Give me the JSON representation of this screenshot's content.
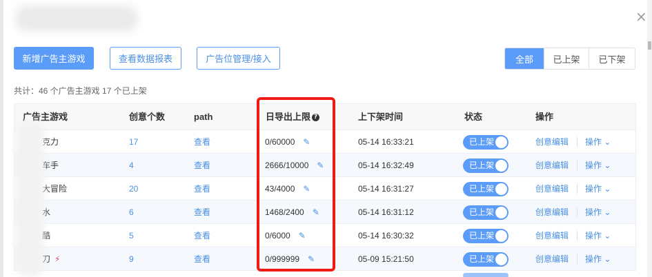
{
  "dialog": {
    "close_icon": "close-icon"
  },
  "toolbar": {
    "add_game_label": "新增广告主游戏",
    "view_report_label": "查看数据报表",
    "ad_position_label": "广告位管理/接入"
  },
  "filter": {
    "all": "全部",
    "listed": "已上架",
    "unlisted": "已下架",
    "active": "all"
  },
  "summary": "共计：46 个广告主游戏   17 个已上架",
  "columns": {
    "game": "广告主游戏",
    "creatives": "创意个数",
    "path": "path",
    "daily_limit": "日导出上限",
    "time": "上下架时间",
    "status": "状态",
    "actions": "操作"
  },
  "rows": [
    {
      "name": "克力",
      "creatives": "17",
      "path": "查看",
      "limit": "0/60000",
      "time": "05-14 16:33:21",
      "status": "已上架",
      "edit": "创意编辑",
      "more": "操作 ⌄",
      "bolt": ""
    },
    {
      "name": "车手",
      "creatives": "4",
      "path": "查看",
      "limit": "2666/10000",
      "time": "05-14 16:32:49",
      "status": "已上架",
      "edit": "创意编辑",
      "more": "操作 ⌄",
      "bolt": ""
    },
    {
      "name": "大冒险",
      "creatives": "20",
      "path": "查看",
      "limit": "43/4000",
      "time": "05-14 16:31:27",
      "status": "已上架",
      "edit": "创意编辑",
      "more": "操作 ⌄",
      "bolt": ""
    },
    {
      "name": "水",
      "creatives": "6",
      "path": "查看",
      "limit": "1468/2400",
      "time": "05-14 16:31:12",
      "status": "已上架",
      "edit": "创意编辑",
      "more": "操作 ⌄",
      "bolt": ""
    },
    {
      "name": "酷",
      "creatives": "5",
      "path": "查看",
      "limit": "0/6000",
      "time": "05-14 16:30:32",
      "status": "已上架",
      "edit": "创意编辑",
      "more": "操作 ⌄",
      "bolt": ""
    },
    {
      "name": "刀",
      "creatives": "9",
      "path": "查看",
      "limit": "0/999999",
      "time": "05-09 15:21:50",
      "status": "已上架",
      "edit": "创意编辑",
      "more": "操作 ⌄",
      "bolt": "⚡"
    }
  ],
  "colors": {
    "primary": "#5b9cf8",
    "highlight": "#ef1a14",
    "bolt": "#f0437a"
  }
}
